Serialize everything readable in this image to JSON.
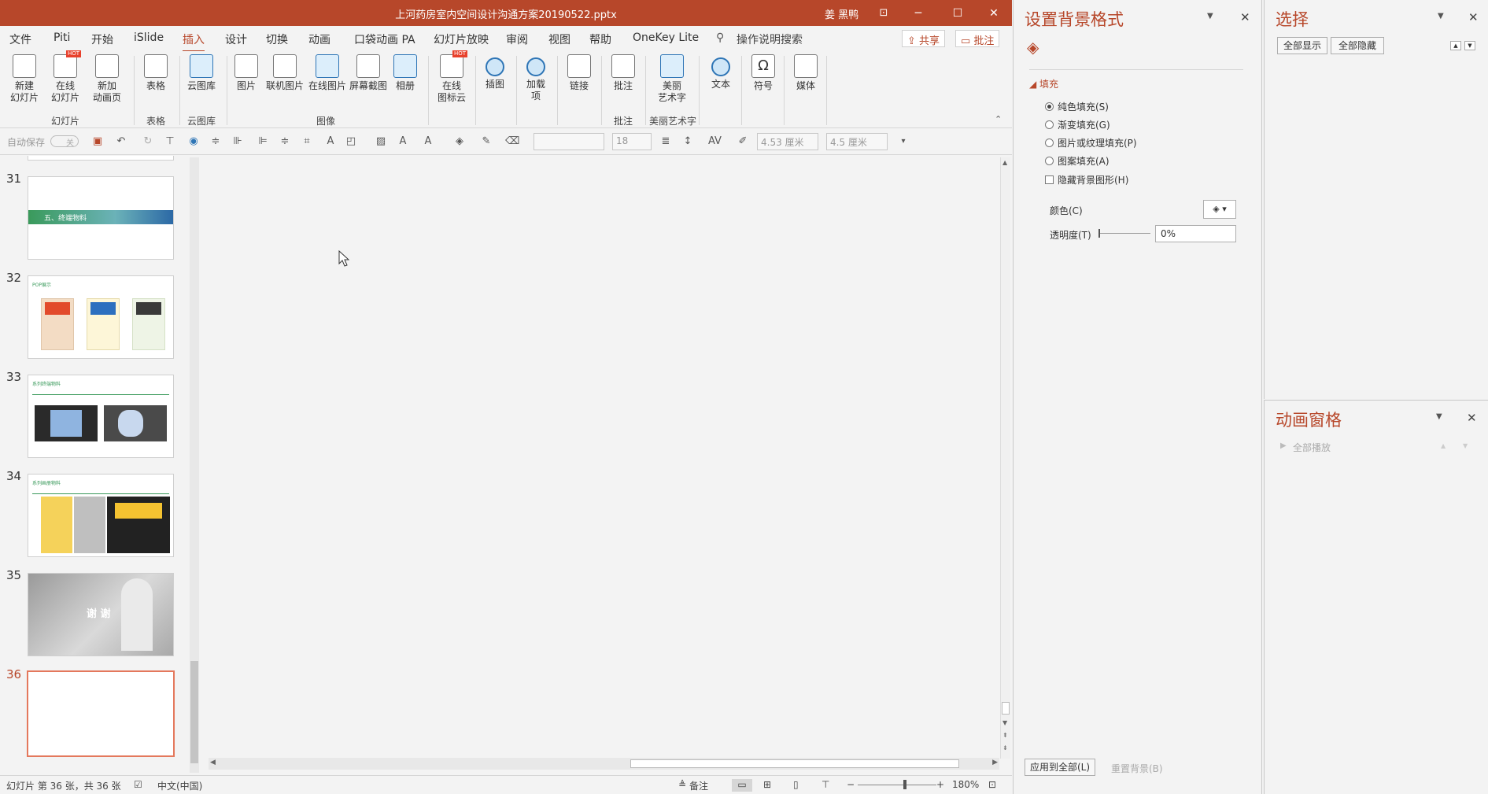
{
  "window": {
    "title": "上河药房室内空间设计沟通方案20190522.pptx",
    "user": "姜 黑鸭",
    "minimize": "─",
    "restore": "☐",
    "close": "✕",
    "ribbon_display": "⊡"
  },
  "tabs": [
    "文件",
    "Piti",
    "开始",
    "iSlide",
    "插入",
    "设计",
    "切换",
    "动画",
    "口袋动画 PA",
    "幻灯片放映",
    "审阅",
    "视图",
    "帮助",
    "OneKey Lite"
  ],
  "active_tab": "插入",
  "search_label": "操作说明搜索",
  "share_label": "共享",
  "comment_label": "批注",
  "ribbon": {
    "new_slide": "新建\n幻灯片",
    "online_slide": "在线\n幻灯片",
    "new_anim_page": "新加\n动画页",
    "table": "表格",
    "cloud_library": "云图库",
    "picture": "图片",
    "online_pictures": "联机图片",
    "online_image": "在线图片",
    "screenshot": "屏幕截图",
    "album": "相册",
    "online_icon_cloud": "在线\n图标云",
    "illustration": "插图",
    "addins": "加载\n项",
    "link": "链接",
    "comment": "批注",
    "wordart_beauty": "美丽\n艺术字",
    "text": "文本",
    "symbol": "符号",
    "media": "媒体",
    "hot": "HOT",
    "groups": {
      "slides": "幻灯片",
      "tables": "表格",
      "cloud": "云图库",
      "images": "图像",
      "comments": "批注",
      "wordart": "美丽艺术字"
    }
  },
  "qat": {
    "autosave": "自动保存",
    "autosave_state": "关",
    "font_size": "18",
    "height": "4.53 厘米",
    "width": "4.5 厘米"
  },
  "slides": [
    {
      "num": "31",
      "caption": "五、终端物料"
    },
    {
      "num": "32",
      "caption": "POP展示"
    },
    {
      "num": "33",
      "caption": "系列终端物料"
    },
    {
      "num": "34",
      "caption": "系列画册物料"
    },
    {
      "num": "35",
      "caption": "谢 谢"
    },
    {
      "num": "36",
      "caption": ""
    }
  ],
  "status": {
    "slide_info": "幻灯片 第 36 张，共 36 张",
    "language": "中文(中国)",
    "notes": "备注",
    "zoom": "180%"
  },
  "bg_pane": {
    "title": "设置背景格式",
    "section": "填充",
    "options": [
      "纯色填充(S)",
      "渐变填充(G)",
      "图片或纹理填充(P)",
      "图案填充(A)"
    ],
    "selected_option": "纯色填充(S)",
    "hide_bg": "隐藏背景图形(H)",
    "color_label": "颜色(C)",
    "transparency_label": "透明度(T)",
    "transparency_value": "0%",
    "transparency_level_percent": 0,
    "apply_all": "应用到全部(L)",
    "reset_bg": "重置背景(B)"
  },
  "selection_pane": {
    "title": "选择",
    "show_all": "全部显示",
    "hide_all": "全部隐藏"
  },
  "animation_pane": {
    "title": "动画窗格",
    "play_all": "全部播放"
  }
}
